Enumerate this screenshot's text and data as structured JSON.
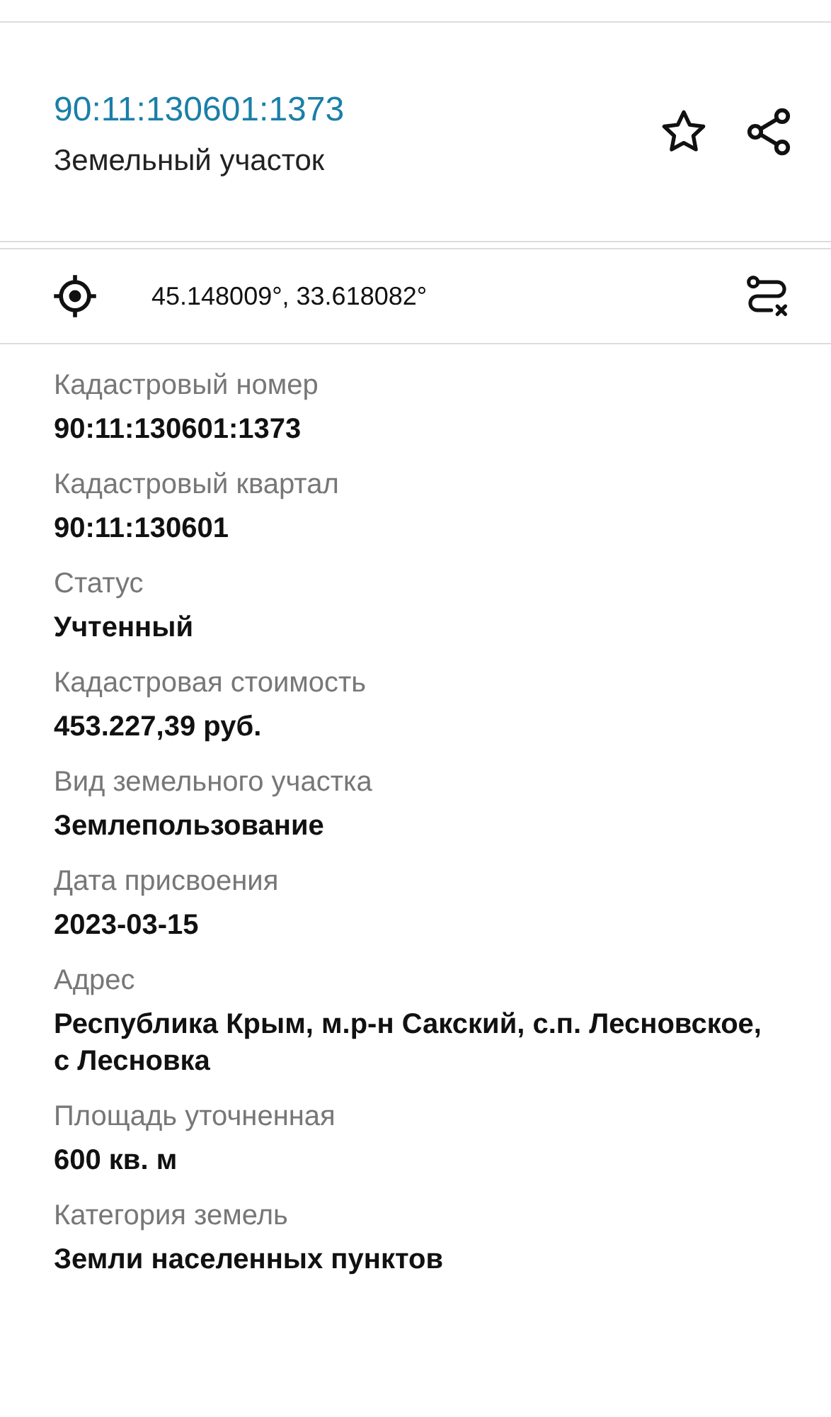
{
  "header": {
    "title": "90:11:130601:1373",
    "subtitle": "Земельный участок"
  },
  "location": {
    "coordinates": "45.148009°, 33.618082°"
  },
  "fields": [
    {
      "label": "Кадастровый номер",
      "value": "90:11:130601:1373"
    },
    {
      "label": "Кадастровый квартал",
      "value": "90:11:130601"
    },
    {
      "label": "Статус",
      "value": "Учтенный"
    },
    {
      "label": "Кадастровая стоимость",
      "value": "453.227,39 руб."
    },
    {
      "label": "Вид земельного участка",
      "value": "Землепользование"
    },
    {
      "label": "Дата присвоения",
      "value": "2023-03-15"
    },
    {
      "label": "Адрес",
      "value": "Республика Крым, м.р-н Сакский, с.п. Лесновское, с Лесновка"
    },
    {
      "label": "Площадь уточненная",
      "value": "600 кв. м"
    },
    {
      "label": "Категория земель",
      "value": "Земли населенных пунктов"
    }
  ]
}
